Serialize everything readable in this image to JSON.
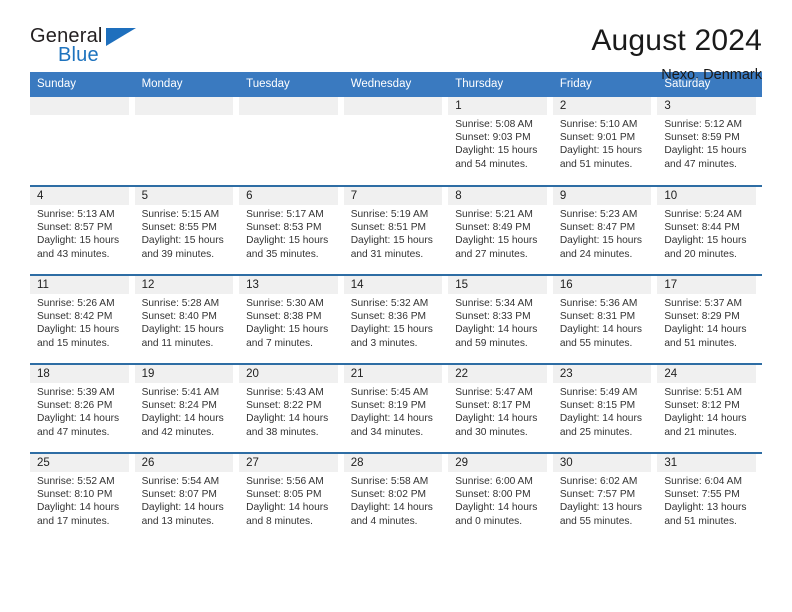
{
  "brand": {
    "name_part1": "General",
    "name_part2": "Blue",
    "accent_color": "#1e6fbd"
  },
  "header": {
    "month_title": "August 2024",
    "location": "Nexo, Denmark",
    "header_bg_color": "#3a7ac0",
    "row_rule_color": "#2e6da4"
  },
  "weekdays": [
    "Sunday",
    "Monday",
    "Tuesday",
    "Wednesday",
    "Thursday",
    "Friday",
    "Saturday"
  ],
  "labels": {
    "sunrise_prefix": "Sunrise:",
    "sunset_prefix": "Sunset:",
    "daylight_prefix": "Daylight:"
  },
  "weeks": [
    [
      {
        "day": "",
        "empty": true
      },
      {
        "day": "",
        "empty": true
      },
      {
        "day": "",
        "empty": true
      },
      {
        "day": "",
        "empty": true
      },
      {
        "day": "1",
        "sunrise": "Sunrise: 5:08 AM",
        "sunset": "Sunset: 9:03 PM",
        "daylight_line1": "Daylight: 15 hours",
        "daylight_line2": "and 54 minutes."
      },
      {
        "day": "2",
        "sunrise": "Sunrise: 5:10 AM",
        "sunset": "Sunset: 9:01 PM",
        "daylight_line1": "Daylight: 15 hours",
        "daylight_line2": "and 51 minutes."
      },
      {
        "day": "3",
        "sunrise": "Sunrise: 5:12 AM",
        "sunset": "Sunset: 8:59 PM",
        "daylight_line1": "Daylight: 15 hours",
        "daylight_line2": "and 47 minutes."
      }
    ],
    [
      {
        "day": "4",
        "sunrise": "Sunrise: 5:13 AM",
        "sunset": "Sunset: 8:57 PM",
        "daylight_line1": "Daylight: 15 hours",
        "daylight_line2": "and 43 minutes."
      },
      {
        "day": "5",
        "sunrise": "Sunrise: 5:15 AM",
        "sunset": "Sunset: 8:55 PM",
        "daylight_line1": "Daylight: 15 hours",
        "daylight_line2": "and 39 minutes."
      },
      {
        "day": "6",
        "sunrise": "Sunrise: 5:17 AM",
        "sunset": "Sunset: 8:53 PM",
        "daylight_line1": "Daylight: 15 hours",
        "daylight_line2": "and 35 minutes."
      },
      {
        "day": "7",
        "sunrise": "Sunrise: 5:19 AM",
        "sunset": "Sunset: 8:51 PM",
        "daylight_line1": "Daylight: 15 hours",
        "daylight_line2": "and 31 minutes."
      },
      {
        "day": "8",
        "sunrise": "Sunrise: 5:21 AM",
        "sunset": "Sunset: 8:49 PM",
        "daylight_line1": "Daylight: 15 hours",
        "daylight_line2": "and 27 minutes."
      },
      {
        "day": "9",
        "sunrise": "Sunrise: 5:23 AM",
        "sunset": "Sunset: 8:47 PM",
        "daylight_line1": "Daylight: 15 hours",
        "daylight_line2": "and 24 minutes."
      },
      {
        "day": "10",
        "sunrise": "Sunrise: 5:24 AM",
        "sunset": "Sunset: 8:44 PM",
        "daylight_line1": "Daylight: 15 hours",
        "daylight_line2": "and 20 minutes."
      }
    ],
    [
      {
        "day": "11",
        "sunrise": "Sunrise: 5:26 AM",
        "sunset": "Sunset: 8:42 PM",
        "daylight_line1": "Daylight: 15 hours",
        "daylight_line2": "and 15 minutes."
      },
      {
        "day": "12",
        "sunrise": "Sunrise: 5:28 AM",
        "sunset": "Sunset: 8:40 PM",
        "daylight_line1": "Daylight: 15 hours",
        "daylight_line2": "and 11 minutes."
      },
      {
        "day": "13",
        "sunrise": "Sunrise: 5:30 AM",
        "sunset": "Sunset: 8:38 PM",
        "daylight_line1": "Daylight: 15 hours",
        "daylight_line2": "and 7 minutes."
      },
      {
        "day": "14",
        "sunrise": "Sunrise: 5:32 AM",
        "sunset": "Sunset: 8:36 PM",
        "daylight_line1": "Daylight: 15 hours",
        "daylight_line2": "and 3 minutes."
      },
      {
        "day": "15",
        "sunrise": "Sunrise: 5:34 AM",
        "sunset": "Sunset: 8:33 PM",
        "daylight_line1": "Daylight: 14 hours",
        "daylight_line2": "and 59 minutes."
      },
      {
        "day": "16",
        "sunrise": "Sunrise: 5:36 AM",
        "sunset": "Sunset: 8:31 PM",
        "daylight_line1": "Daylight: 14 hours",
        "daylight_line2": "and 55 minutes."
      },
      {
        "day": "17",
        "sunrise": "Sunrise: 5:37 AM",
        "sunset": "Sunset: 8:29 PM",
        "daylight_line1": "Daylight: 14 hours",
        "daylight_line2": "and 51 minutes."
      }
    ],
    [
      {
        "day": "18",
        "sunrise": "Sunrise: 5:39 AM",
        "sunset": "Sunset: 8:26 PM",
        "daylight_line1": "Daylight: 14 hours",
        "daylight_line2": "and 47 minutes."
      },
      {
        "day": "19",
        "sunrise": "Sunrise: 5:41 AM",
        "sunset": "Sunset: 8:24 PM",
        "daylight_line1": "Daylight: 14 hours",
        "daylight_line2": "and 42 minutes."
      },
      {
        "day": "20",
        "sunrise": "Sunrise: 5:43 AM",
        "sunset": "Sunset: 8:22 PM",
        "daylight_line1": "Daylight: 14 hours",
        "daylight_line2": "and 38 minutes."
      },
      {
        "day": "21",
        "sunrise": "Sunrise: 5:45 AM",
        "sunset": "Sunset: 8:19 PM",
        "daylight_line1": "Daylight: 14 hours",
        "daylight_line2": "and 34 minutes."
      },
      {
        "day": "22",
        "sunrise": "Sunrise: 5:47 AM",
        "sunset": "Sunset: 8:17 PM",
        "daylight_line1": "Daylight: 14 hours",
        "daylight_line2": "and 30 minutes."
      },
      {
        "day": "23",
        "sunrise": "Sunrise: 5:49 AM",
        "sunset": "Sunset: 8:15 PM",
        "daylight_line1": "Daylight: 14 hours",
        "daylight_line2": "and 25 minutes."
      },
      {
        "day": "24",
        "sunrise": "Sunrise: 5:51 AM",
        "sunset": "Sunset: 8:12 PM",
        "daylight_line1": "Daylight: 14 hours",
        "daylight_line2": "and 21 minutes."
      }
    ],
    [
      {
        "day": "25",
        "sunrise": "Sunrise: 5:52 AM",
        "sunset": "Sunset: 8:10 PM",
        "daylight_line1": "Daylight: 14 hours",
        "daylight_line2": "and 17 minutes."
      },
      {
        "day": "26",
        "sunrise": "Sunrise: 5:54 AM",
        "sunset": "Sunset: 8:07 PM",
        "daylight_line1": "Daylight: 14 hours",
        "daylight_line2": "and 13 minutes."
      },
      {
        "day": "27",
        "sunrise": "Sunrise: 5:56 AM",
        "sunset": "Sunset: 8:05 PM",
        "daylight_line1": "Daylight: 14 hours",
        "daylight_line2": "and 8 minutes."
      },
      {
        "day": "28",
        "sunrise": "Sunrise: 5:58 AM",
        "sunset": "Sunset: 8:02 PM",
        "daylight_line1": "Daylight: 14 hours",
        "daylight_line2": "and 4 minutes."
      },
      {
        "day": "29",
        "sunrise": "Sunrise: 6:00 AM",
        "sunset": "Sunset: 8:00 PM",
        "daylight_line1": "Daylight: 14 hours",
        "daylight_line2": "and 0 minutes."
      },
      {
        "day": "30",
        "sunrise": "Sunrise: 6:02 AM",
        "sunset": "Sunset: 7:57 PM",
        "daylight_line1": "Daylight: 13 hours",
        "daylight_line2": "and 55 minutes."
      },
      {
        "day": "31",
        "sunrise": "Sunrise: 6:04 AM",
        "sunset": "Sunset: 7:55 PM",
        "daylight_line1": "Daylight: 13 hours",
        "daylight_line2": "and 51 minutes."
      }
    ]
  ]
}
